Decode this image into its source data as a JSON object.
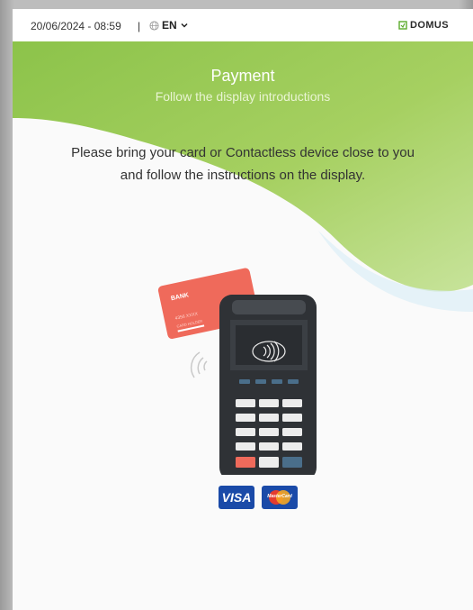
{
  "topbar": {
    "datetime": "20/06/2024 - 08:59",
    "separator": "|",
    "language": "EN",
    "brand": "DOMUS"
  },
  "header": {
    "title": "Payment",
    "subtitle": "Follow the display introductions"
  },
  "instructions": {
    "line1": "Please bring your card or Contactless device close to you",
    "line2": "and follow the instructions on the display."
  },
  "card": {
    "bank": "BANK",
    "number": "4356  XXXX",
    "holder": "CARD HOLDER"
  },
  "payment_logos": {
    "visa": "VISA",
    "mastercard": "MasterCard"
  },
  "colors": {
    "accent_green": "#8cc34a",
    "card_red": "#ef6a5b",
    "terminal": "#2f3236",
    "brand_blue": "#1a4aa8"
  }
}
